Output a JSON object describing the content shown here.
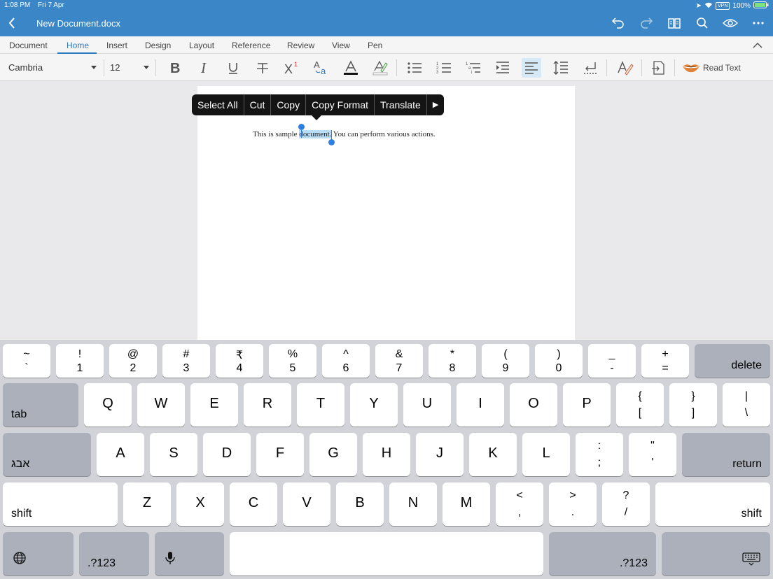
{
  "status": {
    "time": "1:08 PM",
    "date": "Fri 7 Apr",
    "vpn": "VPN",
    "battery": "100%"
  },
  "topbar": {
    "doc_title": "New Document.docx"
  },
  "tabs": [
    "Document",
    "Home",
    "Insert",
    "Design",
    "Layout",
    "Reference",
    "Review",
    "View",
    "Pen"
  ],
  "toolbar": {
    "font_name": "Cambria",
    "font_size": "12",
    "read_text": "Read Text"
  },
  "document": {
    "text_before": "This is sample ",
    "text_selected": "document.",
    "text_after": " You can perform various actions."
  },
  "context_menu": {
    "items": [
      "Select All",
      "Cut",
      "Copy",
      "Copy Format",
      "Translate",
      "▶"
    ]
  },
  "keyboard": {
    "row1": [
      {
        "top": "~",
        "bot": "`"
      },
      {
        "top": "!",
        "bot": "1"
      },
      {
        "top": "@",
        "bot": "2"
      },
      {
        "top": "#",
        "bot": "3"
      },
      {
        "top": "₹",
        "bot": "4"
      },
      {
        "top": "%",
        "bot": "5"
      },
      {
        "top": "^",
        "bot": "6"
      },
      {
        "top": "&",
        "bot": "7"
      },
      {
        "top": "*",
        "bot": "8"
      },
      {
        "top": "(",
        "bot": "9"
      },
      {
        "top": ")",
        "bot": "0"
      },
      {
        "top": "_",
        "bot": "-"
      },
      {
        "top": "+",
        "bot": "="
      }
    ],
    "delete": "delete",
    "tab": "tab",
    "row2": [
      "Q",
      "W",
      "E",
      "R",
      "T",
      "Y",
      "U",
      "I",
      "O",
      "P"
    ],
    "row2_sym": [
      {
        "top": "{",
        "bot": "["
      },
      {
        "top": "}",
        "bot": "]"
      },
      {
        "top": "|",
        "bot": "\\"
      }
    ],
    "lang": "אבג",
    "row3": [
      "A",
      "S",
      "D",
      "F",
      "G",
      "H",
      "J",
      "K",
      "L"
    ],
    "row3_sym": [
      {
        "top": ":",
        "bot": ";"
      },
      {
        "top": "\"",
        "bot": "'"
      }
    ],
    "return": "return",
    "shift": "shift",
    "row4": [
      "Z",
      "X",
      "C",
      "V",
      "B",
      "N",
      "M"
    ],
    "row4_sym": [
      {
        "top": "<",
        "bot": ","
      },
      {
        "top": ">",
        "bot": "."
      },
      {
        "top": "?",
        "bot": "/"
      }
    ],
    "num_label": ".?123"
  },
  "colors": {
    "topbar": "#3a86c6",
    "accent": "#2a7ac0",
    "selection": "#b9dcf7"
  }
}
